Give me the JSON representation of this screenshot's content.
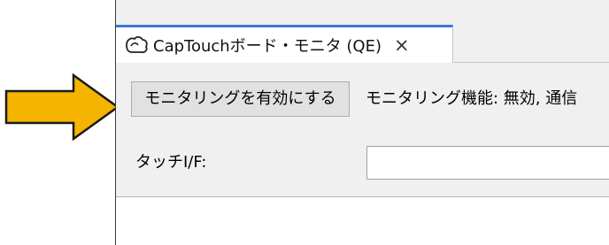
{
  "tab": {
    "title": "CapTouchボード・モニタ (QE)",
    "close_glyph": "×",
    "icon": "hand-touch-icon"
  },
  "toolbar": {
    "enable_button_label": "モニタリングを有効にする",
    "status_text": "モニタリング機能: 無効, 通信"
  },
  "touch_if": {
    "label": "タッチI/F:",
    "value": ""
  },
  "annotation": {
    "arrow_icon": "pointer-arrow-icon",
    "arrow_fill": "#f5b400",
    "arrow_stroke": "#1a1a1a"
  },
  "colors": {
    "tab_accent": "#3c78d8",
    "panel_bg": "#f0f0f0",
    "button_bg": "#e1e1e1"
  }
}
